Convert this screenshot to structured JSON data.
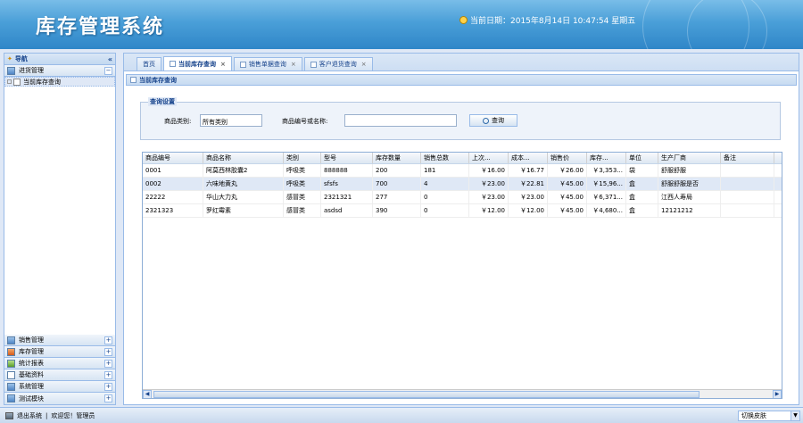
{
  "app_title": "库存管理系统",
  "header": {
    "date_label": "当前日期：2015年8月14日 10:47:54 星期五"
  },
  "sidebar": {
    "title": "导航",
    "collapse": "«",
    "top_section": {
      "label": "进货管理",
      "toggle": "−"
    },
    "tree_items": [
      {
        "label": "当前库存查询"
      }
    ],
    "sections": [
      {
        "label": "销售管理",
        "toggle": "+"
      },
      {
        "label": "库存管理",
        "toggle": "+"
      },
      {
        "label": "统计报表",
        "toggle": "+"
      },
      {
        "label": "基础资料",
        "toggle": "+"
      },
      {
        "label": "系统管理",
        "toggle": "+"
      },
      {
        "label": "测试模块",
        "toggle": "+"
      }
    ]
  },
  "tabs": [
    {
      "label": "首页",
      "closable": false
    },
    {
      "label": "当前库存查询",
      "closable": true
    },
    {
      "label": "销售单据查询",
      "closable": true
    },
    {
      "label": "客户退货查询",
      "closable": true
    }
  ],
  "content_title": "当前库存查询",
  "query": {
    "legend": "查询设置",
    "category_label": "商品类别:",
    "category_value": "所有类别",
    "code_label": "商品编号或名称:",
    "code_value": "",
    "search_button": "查询"
  },
  "grid": {
    "columns": [
      "商品编号",
      "商品名称",
      "类别",
      "型号",
      "库存数量",
      "销售总数",
      "上次...",
      "成本...",
      "销售价",
      "库存...",
      "单位",
      "生产厂商",
      "备注"
    ],
    "rows": [
      [
        "0001",
        "阿莫西林胶囊2",
        "呼吸类",
        "888888",
        "200",
        "181",
        "￥16.00",
        "￥16.77",
        "￥26.00",
        "￥3,353...",
        "袋",
        "舒服舒服",
        ""
      ],
      [
        "0002",
        "六味地黄丸",
        "呼吸类",
        "sfsfs",
        "700",
        "4",
        "￥23.00",
        "￥22.81",
        "￥45.00",
        "￥15,96...",
        "盒",
        "舒服舒服是否",
        ""
      ],
      [
        "22222",
        "华山大力丸",
        "感冒类",
        "2321321",
        "277",
        "0",
        "￥23.00",
        "￥23.00",
        "￥45.00",
        "￥6,371...",
        "盒",
        "江西人寿局",
        ""
      ],
      [
        "2321323",
        "罗红霉素",
        "感冒类",
        "asdsd",
        "390",
        "0",
        "￥12.00",
        "￥12.00",
        "￥45.00",
        "￥4,680...",
        "盒",
        "12121212",
        ""
      ]
    ],
    "selected_row": 1
  },
  "footer": {
    "exit_label": "退出系统",
    "welcome": "欢迎您！管理员",
    "skin_label": "切换皮肤"
  }
}
